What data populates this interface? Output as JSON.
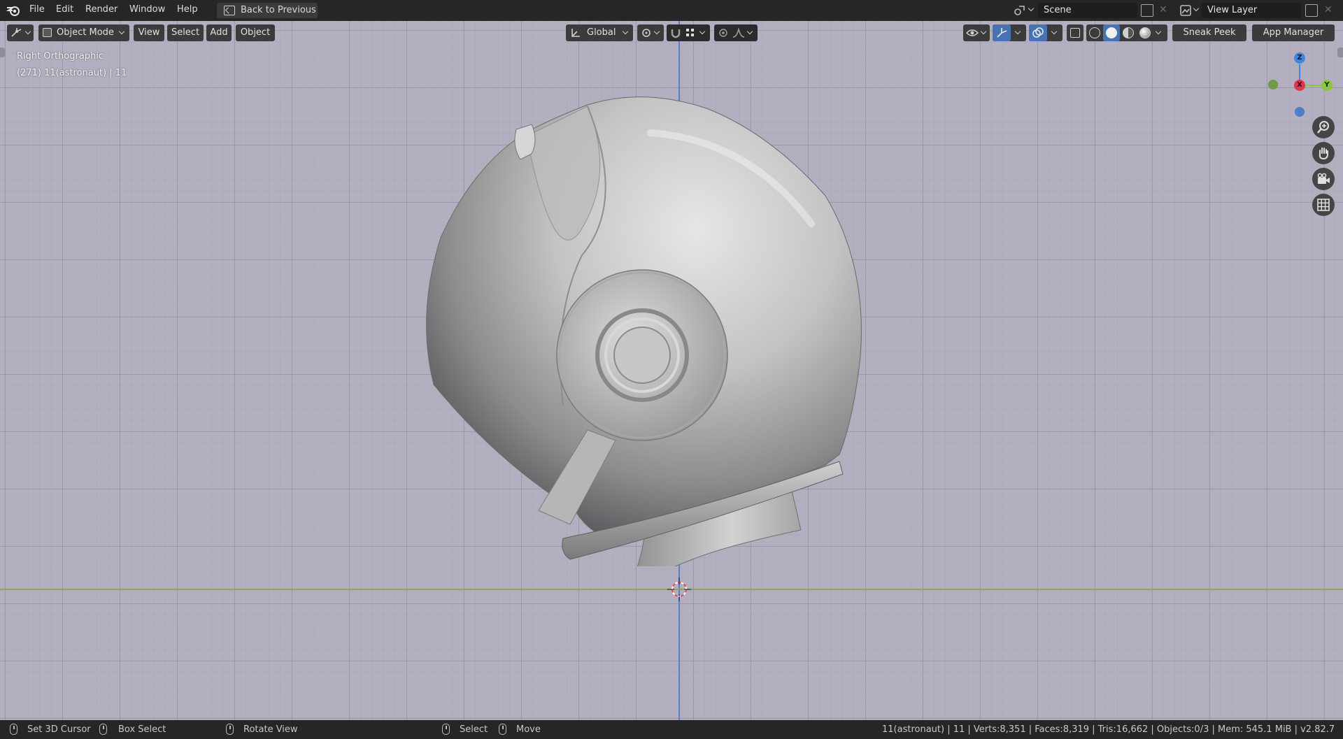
{
  "menu": {
    "items": [
      "File",
      "Edit",
      "Render",
      "Window",
      "Help"
    ],
    "back_to_previous": "Back to Previous"
  },
  "scene": {
    "name": "Scene"
  },
  "view_layer": {
    "name": "View Layer"
  },
  "viewport_header": {
    "mode": "Object Mode",
    "menus": [
      "View",
      "Select",
      "Add",
      "Object"
    ],
    "orientation": "Global",
    "sneak_peek": "Sneak Peek",
    "app_manager": "App Manager"
  },
  "viewport": {
    "view_name": "Right Orthographic",
    "object_info": "(271) 11(astronaut) | 11",
    "background_color": "#b3afc0",
    "axis_colors": {
      "x": "#e0354f",
      "y": "#8cc63f",
      "z": "#3f86e0"
    }
  },
  "gizmo": {
    "z": "Z",
    "x": "X",
    "y": "Y"
  },
  "nav_icons": [
    "zoom-icon",
    "hand-pan-icon",
    "camera-icon",
    "grid-icon"
  ],
  "statusbar": {
    "set_3d_cursor": "Set 3D Cursor",
    "box_select": "Box Select",
    "rotate_view": "Rotate View",
    "select": "Select",
    "move": "Move",
    "stats": "11(astronaut) | 11 | Verts:8,351 | Faces:8,319 | Tris:16,662 | Objects:0/3 | Mem: 545.1 MiB | v2.82.7"
  }
}
